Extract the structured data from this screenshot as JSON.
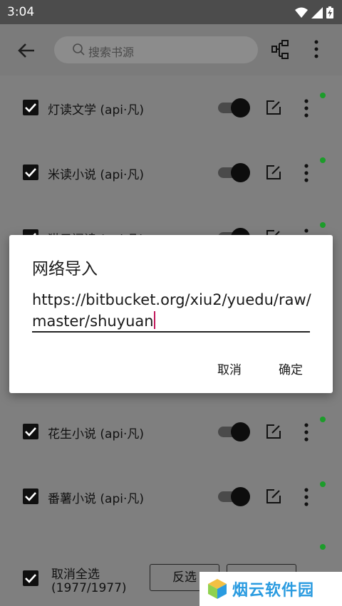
{
  "status": {
    "time": "3:04"
  },
  "header": {
    "search_placeholder": "搜索书源"
  },
  "sources": [
    {
      "name": "灯读文学 (api·凡)"
    },
    {
      "name": "米读小说 (api·凡)"
    },
    {
      "name": "猫子阅读 (api·凡)"
    },
    {
      "name": "花生小说 (api·凡)"
    },
    {
      "name": "番薯小说 (api·凡)"
    }
  ],
  "bottom": {
    "select_all_label": "取消全选",
    "count": "(1977/1977)",
    "invert_label": "反选"
  },
  "dialog": {
    "title": "网络导入",
    "url": "https://bitbucket.org/xiu2/yuedu/raw/master/shuyuan",
    "cancel": "取消",
    "ok": "确定"
  },
  "watermark": {
    "text": "烟云软件园"
  },
  "colors": {
    "accent_caret": "#c2185b",
    "status_dot": "#1c9c2a",
    "watermark": "#2a9be0"
  }
}
